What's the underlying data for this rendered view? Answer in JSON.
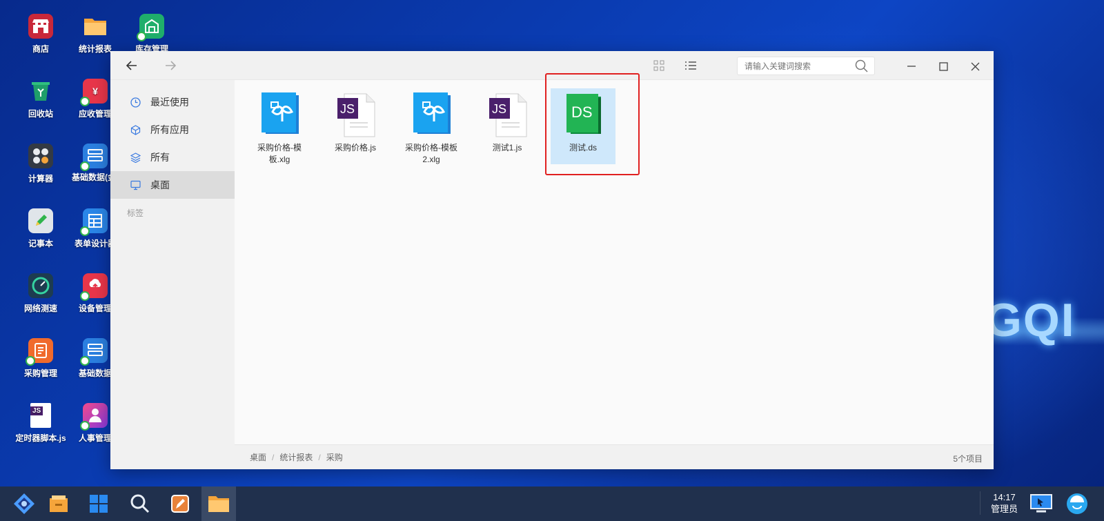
{
  "desktop": {
    "background_logo": "GQI",
    "icons": [
      {
        "label": "商店",
        "icon": "store-icon",
        "color": "#c8283a"
      },
      {
        "label": "统计报表",
        "icon": "folder-icon",
        "color": "#f5a53b"
      },
      {
        "label": "库存管理",
        "icon": "inventory-icon",
        "color": "#1fae6b"
      },
      {
        "label": "回收站",
        "icon": "recycle-bin-icon",
        "color": "#1f9e6a"
      },
      {
        "label": "应收管理",
        "icon": "receivable-icon",
        "color": "#e8364a"
      },
      {
        "label": "计算器",
        "icon": "calculator-icon",
        "color": "#333a44"
      },
      {
        "label": "基础数据(金)",
        "icon": "basic-data-icon",
        "color": "#2b7fe0"
      },
      {
        "label": "记事本",
        "icon": "notepad-icon",
        "color": "#e0e5ea"
      },
      {
        "label": "表单设计器",
        "icon": "form-designer-icon",
        "color": "#2a86e8"
      },
      {
        "label": "网络测速",
        "icon": "speedometer-icon",
        "color": "#1d3c50"
      },
      {
        "label": "设备管理",
        "icon": "device-icon",
        "color": "#e8364a"
      },
      {
        "label": "采购管理",
        "icon": "purchase-icon",
        "color": "#f06a2c"
      },
      {
        "label": "基础数据",
        "icon": "basic-data-icon",
        "color": "#2b7fe0"
      },
      {
        "label": "定时器脚本.js",
        "icon": "js-file-icon",
        "color": "#ffffff"
      },
      {
        "label": "人事管理",
        "icon": "hr-icon",
        "color": "#9b3ae0"
      }
    ]
  },
  "window": {
    "search_placeholder": "请输入关键词搜索",
    "sidebar": {
      "items": [
        {
          "label": "最近使用",
          "icon": "clock-icon"
        },
        {
          "label": "所有应用",
          "icon": "cube-icon"
        },
        {
          "label": "所有",
          "icon": "layers-icon"
        },
        {
          "label": "桌面",
          "icon": "monitor-icon"
        }
      ],
      "section_label": "标签"
    },
    "files": [
      {
        "name": "采购价格-模板.xlg",
        "type": "xlg",
        "badge": ""
      },
      {
        "name": "采购价格.js",
        "type": "js",
        "badge": "JS"
      },
      {
        "name": "采购价格-模板2.xlg",
        "type": "xlg",
        "badge": ""
      },
      {
        "name": "测试1.js",
        "type": "js",
        "badge": "JS"
      },
      {
        "name": "测试.ds",
        "type": "ds",
        "badge": "DS"
      }
    ],
    "breadcrumb": [
      "桌面",
      "统计报表",
      "采购"
    ],
    "item_count": "5个项目"
  },
  "taskbar": {
    "time": "14:17",
    "user": "管理员"
  }
}
